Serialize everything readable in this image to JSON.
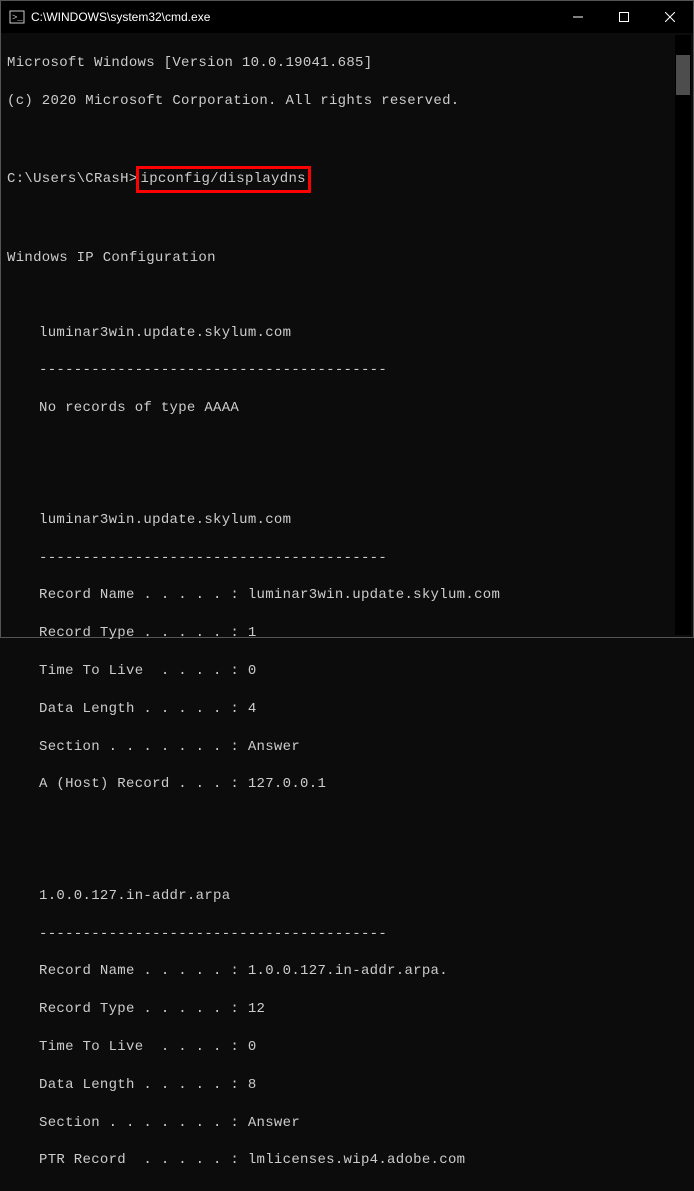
{
  "window": {
    "title": "C:\\WINDOWS\\system32\\cmd.exe"
  },
  "header": {
    "version_line": "Microsoft Windows [Version 10.0.19041.685]",
    "copyright_line": "(c) 2020 Microsoft Corporation. All rights reserved."
  },
  "prompt": {
    "prefix": "C:\\Users\\CRasH>",
    "command": "ipconfig/displaydns"
  },
  "config_header": "Windows IP Configuration",
  "block1": {
    "host": "luminar3win.update.skylum.com",
    "divider": "----------------------------------------",
    "message": "No records of type AAAA"
  },
  "block2": {
    "host": "luminar3win.update.skylum.com",
    "divider": "----------------------------------------",
    "record_name": "Record Name . . . . . : luminar3win.update.skylum.com",
    "record_type": "Record Type . . . . . : 1",
    "ttl": "Time To Live  . . . . : 0",
    "data_length": "Data Length . . . . . : 4",
    "section": "Section . . . . . . . : Answer",
    "a_record": "A (Host) Record . . . : 127.0.0.1"
  },
  "block3": {
    "host": "1.0.0.127.in-addr.arpa",
    "divider": "----------------------------------------",
    "record_name": "Record Name . . . . . : 1.0.0.127.in-addr.arpa.",
    "record_type": "Record Type . . . . . : 12",
    "ttl": "Time To Live  . . . . : 0",
    "data_length": "Data Length . . . . . : 8",
    "section": "Section . . . . . . . : Answer",
    "ptr_record": "PTR Record  . . . . . : lmlicenses.wip4.adobe.com"
  }
}
